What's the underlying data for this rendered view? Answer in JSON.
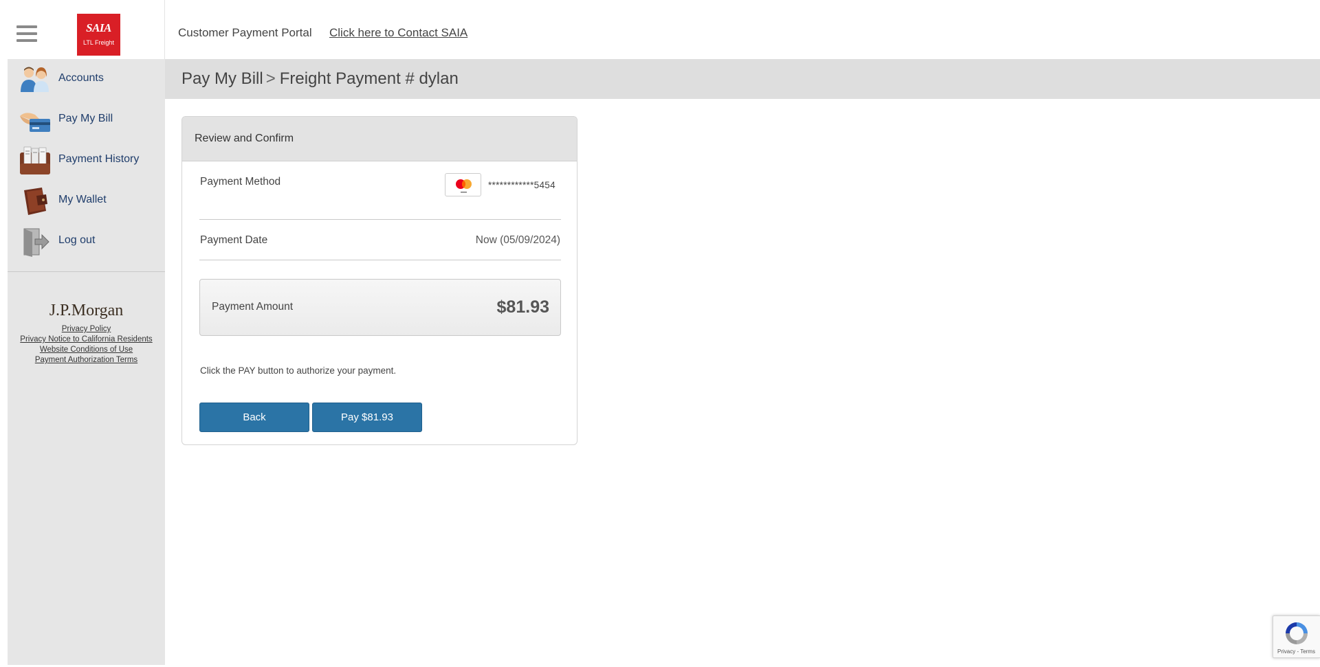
{
  "header": {
    "logo_text": "SAIA",
    "logo_subtext": "LTL Freight",
    "portal_title": "Customer Payment Portal",
    "contact_link": "Click here to Contact SAIA"
  },
  "sidebar": {
    "items": [
      {
        "label": "Accounts",
        "icon": "accounts-icon"
      },
      {
        "label": "Pay My Bill",
        "icon": "pay-bill-icon"
      },
      {
        "label": "Payment History",
        "icon": "payment-history-icon"
      },
      {
        "label": "My Wallet",
        "icon": "wallet-icon"
      },
      {
        "label": "Log out",
        "icon": "logout-icon"
      }
    ],
    "partner_logo": "J.P.Morgan",
    "legal_links": [
      "Privacy Policy",
      "Privacy Notice to California Residents",
      "Website Conditions of Use",
      "Payment Authorization Terms"
    ]
  },
  "breadcrumb": {
    "parent": "Pay My Bill",
    "separator": ">",
    "current": "Freight Payment # dylan"
  },
  "review": {
    "title": "Review and Confirm",
    "payment_method_label": "Payment Method",
    "card_brand": "mastercard",
    "card_masked": "************5454",
    "payment_date_label": "Payment Date",
    "payment_date_value": "Now (05/09/2024)",
    "amount_label": "Payment Amount",
    "amount_value": "$81.93",
    "authorize_text": "Click the PAY button to authorize your payment.",
    "back_button": "Back",
    "pay_button": "Pay $81.93"
  },
  "recaptcha": {
    "links": "Privacy - Terms"
  },
  "colors": {
    "brand_red": "#d91f26",
    "button_blue": "#2b74a6",
    "sidebar_bg": "#e6e6e6",
    "nav_text": "#1f3d6b"
  }
}
